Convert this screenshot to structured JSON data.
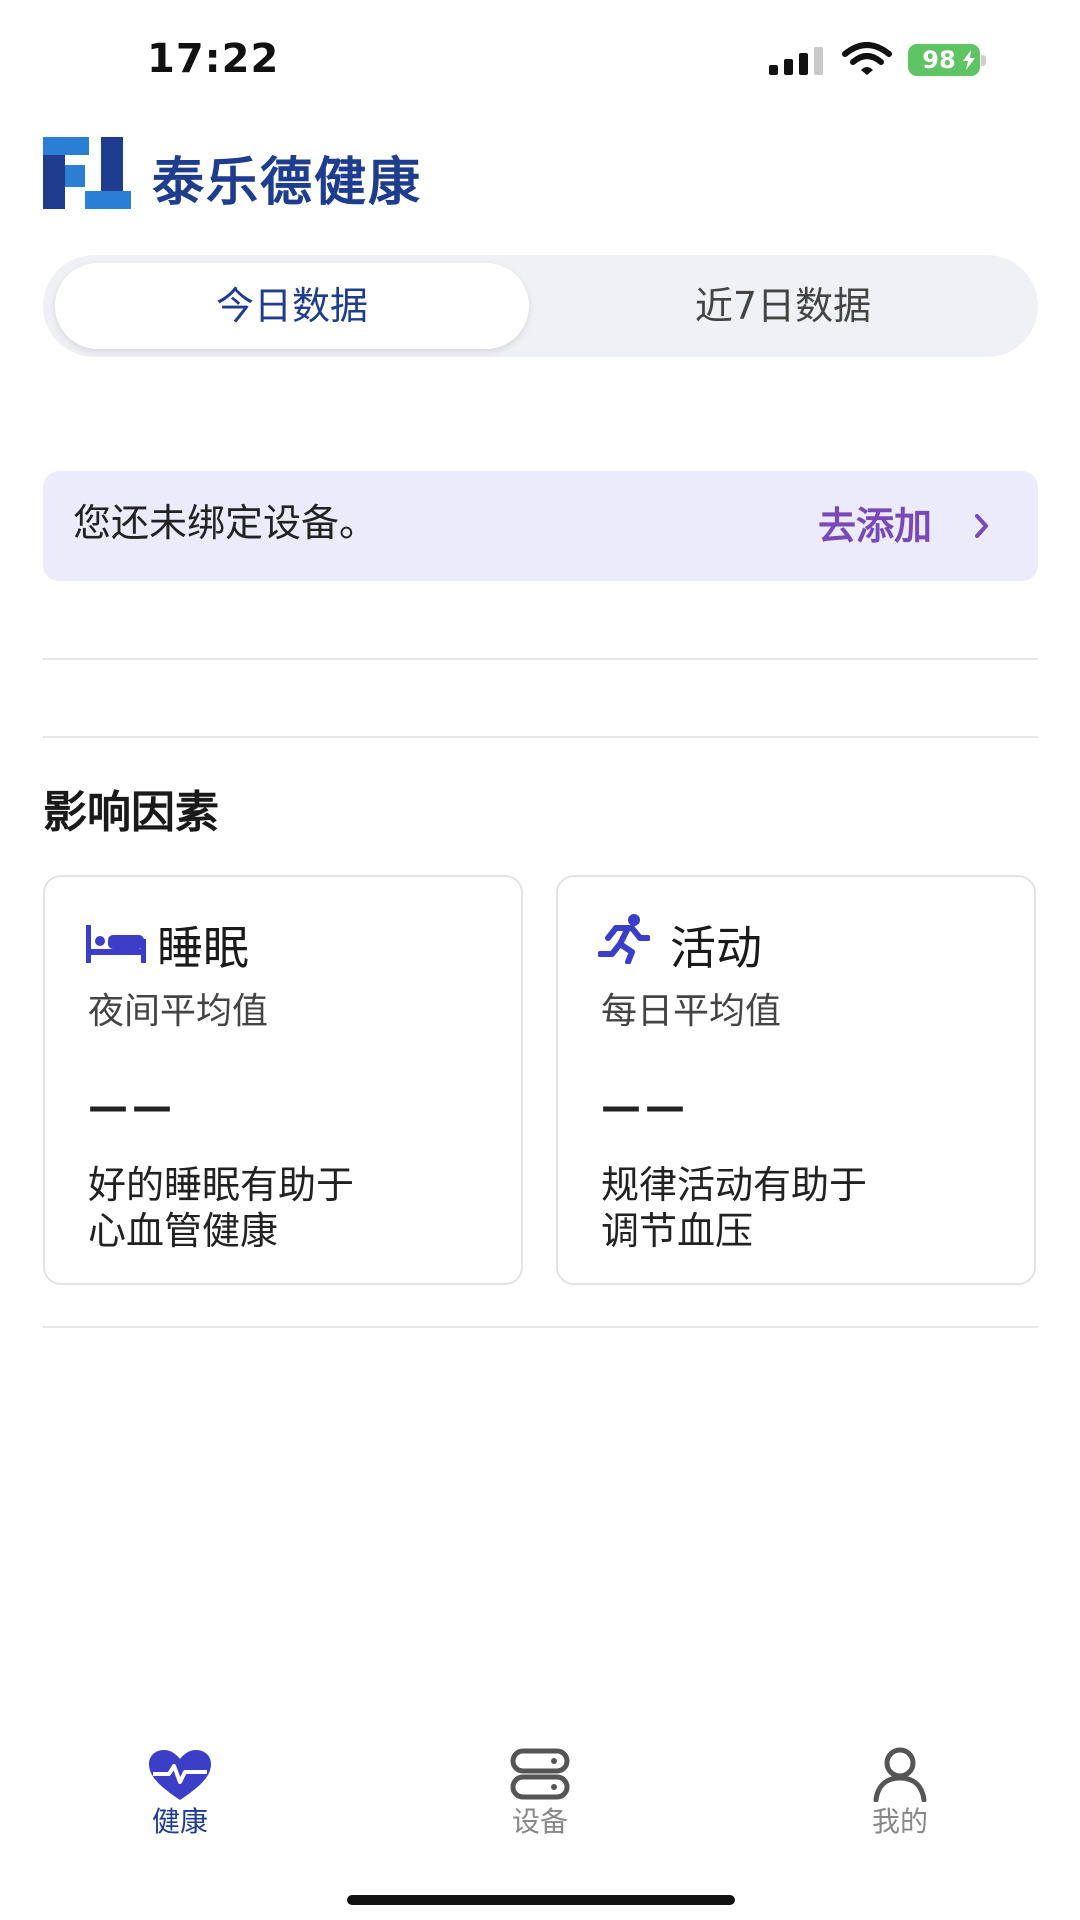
{
  "status_bar": {
    "time": "17:22",
    "battery": "98"
  },
  "header": {
    "brand_name": "泰乐德健康"
  },
  "tabs": [
    {
      "label": "今日数据",
      "active": true
    },
    {
      "label": "近7日数据",
      "active": false
    }
  ],
  "banner": {
    "message": "您还未绑定设备。",
    "action": "去添加"
  },
  "factors": {
    "title": "影响因素",
    "cards": [
      {
        "icon": "bed-icon",
        "title": "睡眠",
        "subtitle": "夜间平均值",
        "value": "——",
        "description_line1": "好的睡眠有助于",
        "description_line2": "心血管健康"
      },
      {
        "icon": "running-icon",
        "title": "活动",
        "subtitle": "每日平均值",
        "value": "——",
        "description_line1": "规律活动有助于",
        "description_line2": "调节血压"
      }
    ]
  },
  "bottom_nav": [
    {
      "label": "健康",
      "icon": "heart-pulse-icon",
      "active": true
    },
    {
      "label": "设备",
      "icon": "device-icon",
      "active": false
    },
    {
      "label": "我的",
      "icon": "user-icon",
      "active": false
    }
  ],
  "colors": {
    "brand": "#1e3d8f",
    "accent_purple": "#7a49b8",
    "nav_active": "#3b3fc7",
    "banner_bg": "#ecebfb",
    "battery": "#5fc463"
  }
}
